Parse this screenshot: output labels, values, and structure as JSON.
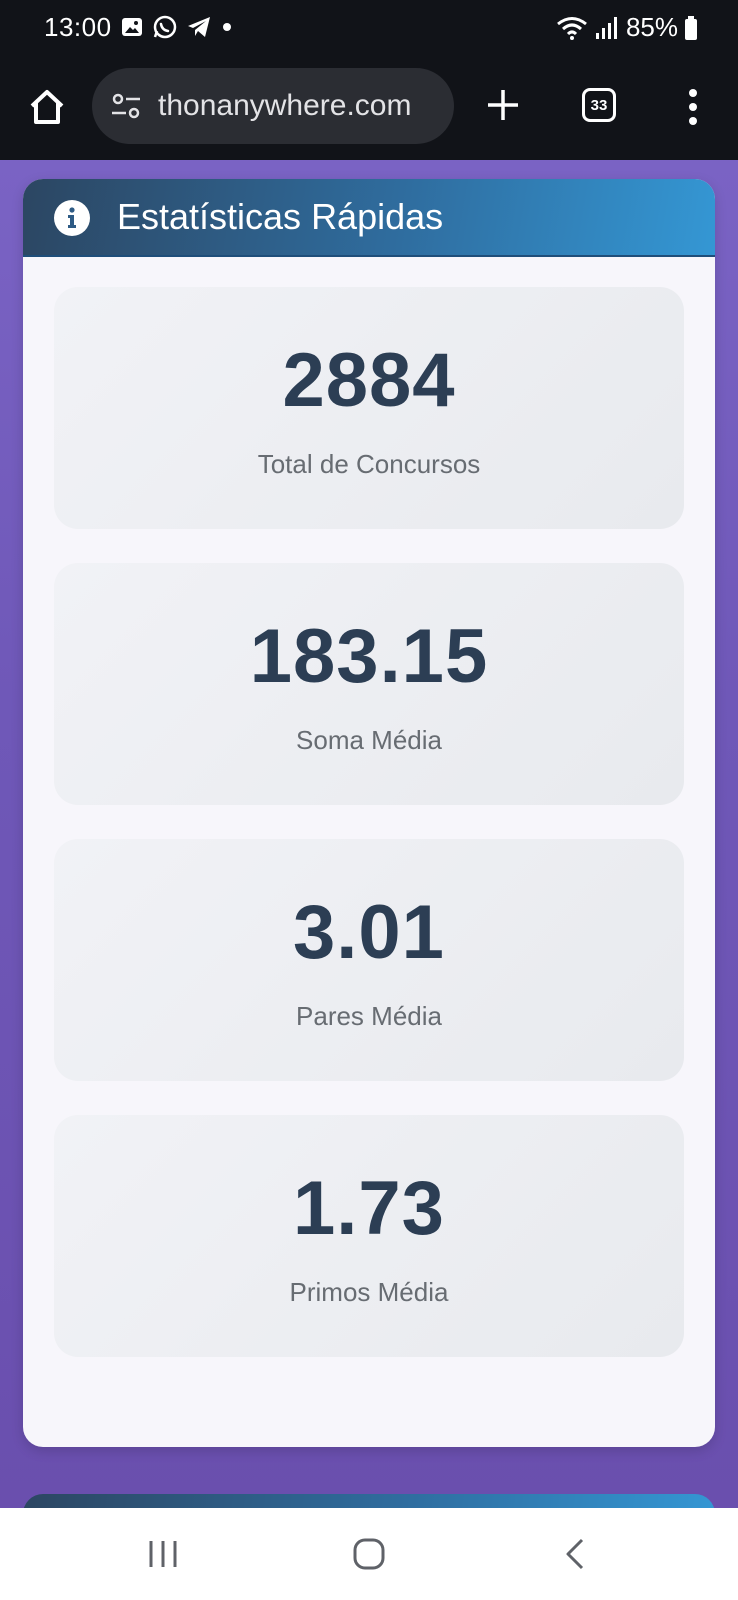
{
  "status_bar": {
    "time": "13:00",
    "battery": "85%",
    "left_icons": [
      "image-icon",
      "whatsapp-icon",
      "telegram-icon",
      "dot-icon"
    ],
    "right_icons": [
      "wifi-icon",
      "signal-icon",
      "battery-icon"
    ]
  },
  "browser": {
    "url": "thonanywhere.com",
    "tab_count": "33"
  },
  "card": {
    "title": "Estatísticas Rápidas",
    "header_icon": "info-icon",
    "colors": {
      "header_start": "#2c4662",
      "header_end": "#3497d4",
      "value_text": "#2c3e54"
    }
  },
  "stats": [
    {
      "value": "2884",
      "label": "Total de Concursos"
    },
    {
      "value": "183.15",
      "label": "Soma Média"
    },
    {
      "value": "3.01",
      "label": "Pares Média"
    },
    {
      "value": "1.73",
      "label": "Primos Média"
    }
  ],
  "nav_bar": {
    "buttons": [
      "recent-apps-icon",
      "home-icon",
      "back-icon"
    ]
  }
}
